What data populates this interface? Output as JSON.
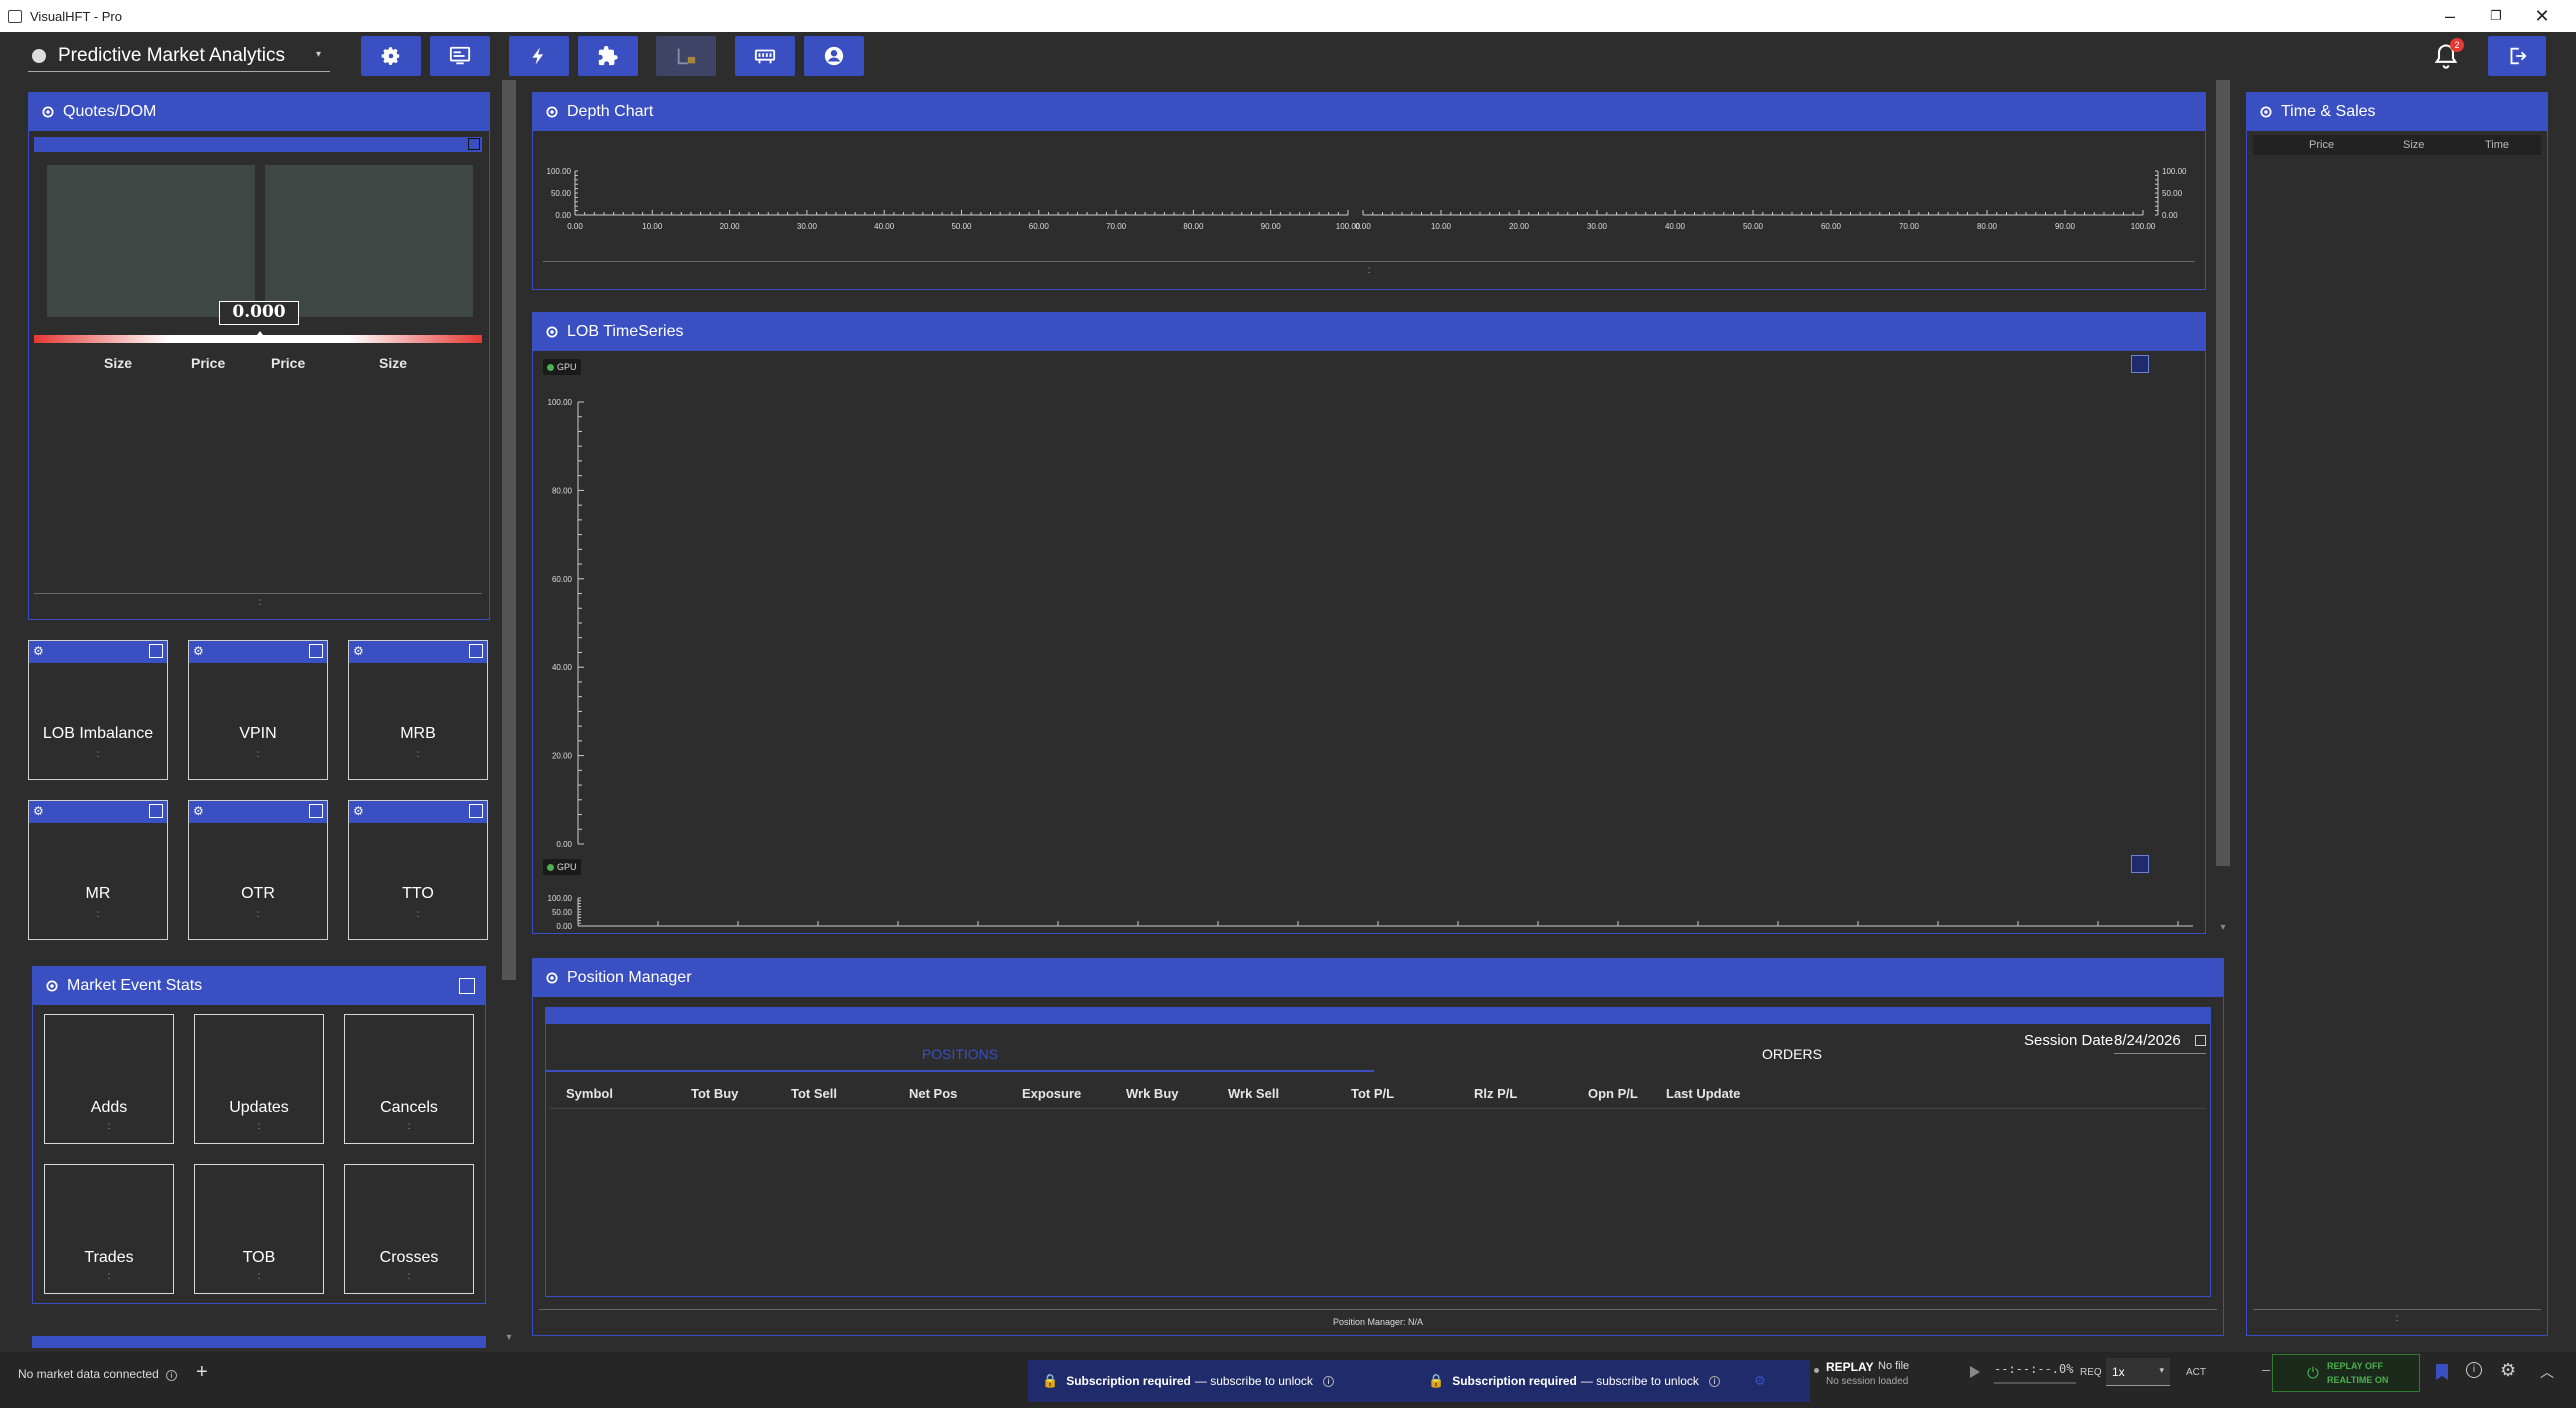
{
  "window": {
    "title": "VisualHFT - Pro"
  },
  "toolbar": {
    "layout_select": "Predictive Market Analytics",
    "buttons": [
      "settings",
      "monitor",
      "flash",
      "plugins",
      "locked-report",
      "server",
      "user"
    ],
    "notification_count": "2"
  },
  "quotes": {
    "title": "Quotes/DOM",
    "mid_price": "0.000",
    "columns": [
      "Size",
      "Price",
      "Price",
      "Size"
    ]
  },
  "studies": {
    "row1": [
      "LOB Imbalance",
      "VPIN",
      "MRB"
    ],
    "row2": [
      "MR",
      "OTR",
      "TTO"
    ],
    "dots": ":"
  },
  "market_event_stats": {
    "title": "Market Event Stats",
    "row1": [
      "Adds",
      "Updates",
      "Cancels"
    ],
    "row2": [
      "Trades",
      "TOB",
      "Crosses"
    ]
  },
  "depth_chart": {
    "title": "Depth Chart",
    "left_y_ticks": [
      "100.00",
      "50.00",
      "0.00"
    ],
    "right_y_ticks": [
      "100.00",
      "50.00",
      "0.00"
    ],
    "x_ticks": [
      "0.00",
      "10.00",
      "20.00",
      "30.00",
      "40.00",
      "50.00",
      "60.00",
      "70.00",
      "80.00",
      "90.00",
      "100.00"
    ]
  },
  "lob_timeseries": {
    "title": "LOB TimeSeries",
    "gpu_badge": "GPU",
    "y_ticks": [
      "100.00",
      "80.00",
      "60.00",
      "40.00",
      "20.00",
      "0.00"
    ],
    "small_y_ticks": [
      "100.00",
      "50.00",
      "0.00"
    ]
  },
  "position_manager": {
    "title": "Position Manager",
    "tab_positions": "POSITIONS",
    "tab_orders": "ORDERS",
    "session_date_label": "Session Date",
    "session_date": "8/24/2026",
    "columns": [
      "Symbol",
      "Tot Buy",
      "Tot Sell",
      "Net Pos",
      "Exposure",
      "Wrk Buy",
      "Wrk Sell",
      "Tot P/L",
      "Rlz P/L",
      "Opn P/L",
      "Last Update"
    ],
    "footer": "Position Manager: N/A"
  },
  "time_sales": {
    "title": "Time & Sales",
    "columns": [
      "Price",
      "Size",
      "Time"
    ]
  },
  "statusbar": {
    "market_data": "No market data connected",
    "sub1_bold": "Subscription required",
    "sub1_rest": "— subscribe to unlock",
    "sub2_bold": "Subscription required",
    "sub2_rest": "— subscribe to unlock",
    "replay_label": "REPLAY",
    "replay_file": "No file",
    "replay_session": "No session loaded",
    "time_display": "--:--:--.0%",
    "req_label": "REQ",
    "speed": "1x",
    "act_label": "ACT",
    "replay_off": "REPLAY OFF",
    "realtime_on": "REALTIME ON"
  },
  "colors": {
    "accent": "#3a4fc1",
    "bg": "#2d2d2d",
    "green": "#2e7d32"
  }
}
